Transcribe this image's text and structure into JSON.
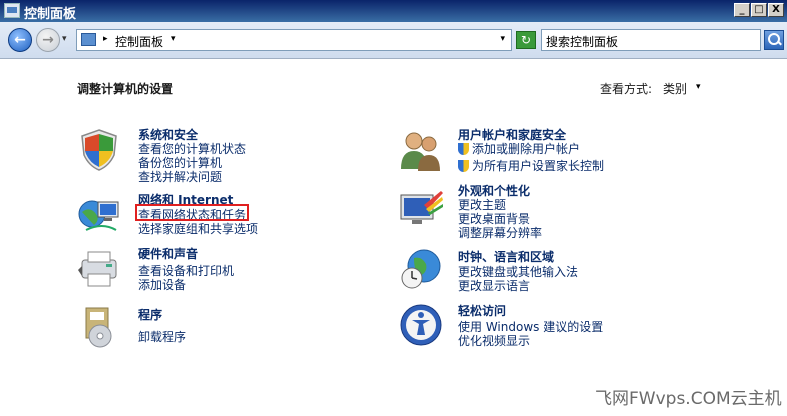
{
  "window": {
    "title": "控制面板",
    "min": "_",
    "max": "□",
    "close": "X"
  },
  "toolbar": {
    "back": "←",
    "forward": "→",
    "history": "▾",
    "breadcrumb_sep": "▸",
    "breadcrumb": "控制面板",
    "breadcrumb_arrow": "▾",
    "address_drop": "▾",
    "refresh": "↻",
    "search_text": "搜索控制面板"
  },
  "main": {
    "heading": "调整计算机的设置",
    "view_by_label": "查看方式:",
    "view_by_value": "类别",
    "view_by_arrow": "▾"
  },
  "categories": [
    {
      "title": "系统和安全",
      "links": [
        "查看您的计算机状态",
        "备份您的计算机",
        "查找并解决问题"
      ],
      "icon": "shield-icon"
    },
    {
      "title": "网络和 Internet",
      "links": [
        "查看网络状态和任务",
        "选择家庭组和共享选项"
      ],
      "icon": "network-icon"
    },
    {
      "title": "硬件和声音",
      "links": [
        "查看设备和打印机",
        "添加设备"
      ],
      "icon": "printer-icon"
    },
    {
      "title": "程序",
      "links": [
        "卸载程序"
      ],
      "icon": "programs-icon"
    },
    {
      "title": "用户帐户和家庭安全",
      "links": [
        "添加或删除用户帐户",
        "为所有用户设置家长控制"
      ],
      "icon": "users-icon"
    },
    {
      "title": "外观和个性化",
      "links": [
        "更改主题",
        "更改桌面背景",
        "调整屏幕分辨率"
      ],
      "icon": "display-icon"
    },
    {
      "title": "时钟、语言和区域",
      "links": [
        "更改键盘或其他输入法",
        "更改显示语言"
      ],
      "icon": "globe-clock-icon"
    },
    {
      "title": "轻松访问",
      "links": [
        "使用 Windows 建议的设置",
        "优化视频显示"
      ],
      "icon": "accessibility-icon"
    }
  ],
  "watermark": "飞网FWvps.COM云主机"
}
